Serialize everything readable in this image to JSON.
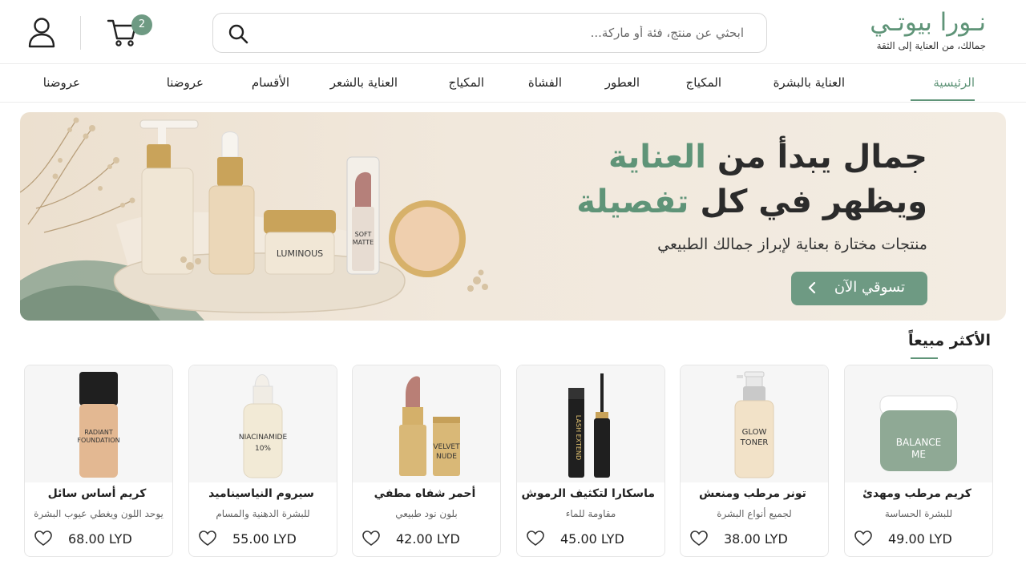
{
  "brand": {
    "name": "نـورا بيوتـي",
    "tagline": "جمالك، من العناية إلى الثقة"
  },
  "search": {
    "placeholder": "ابحثي عن منتج، فئة أو ماركة..."
  },
  "cart": {
    "count": "2"
  },
  "nav": {
    "items": [
      "الرئيسية",
      "العناية بالبشرة",
      "المكياج",
      "العطور",
      "الفشاة",
      "المكياج",
      "العناية بالشعر",
      "الأقسام",
      "عروضنا",
      "عروضنا"
    ]
  },
  "hero": {
    "line1_dark": "جمال يبدأ من",
    "line1_accent": "العناية",
    "line2_dark": "ويظهر في كل",
    "line2_accent": "تفصيلة",
    "subtitle": "منتجات مختارة بعناية لإبراز جمالك الطبيعي",
    "cta": "تسوقي الآن",
    "jar_label": "LUMINOUS",
    "lipstick_label_1": "SOFT",
    "lipstick_label_2": "MATTE"
  },
  "section": {
    "title": "الأكثر مبيعاً"
  },
  "products": [
    {
      "name": "كريم مرطب ومهدئ",
      "desc": "للبشرة الحساسة",
      "price": "49.00 LYD",
      "label1": "BALANCE",
      "label2": "ME"
    },
    {
      "name": "تونر مرطب ومنعش",
      "desc": "لجميع أنواع البشرة",
      "price": "38.00 LYD",
      "label1": "GLOW",
      "label2": "TONER"
    },
    {
      "name": "ماسكارا لتكثيف الرموش",
      "desc": "مقاومة للماء",
      "price": "45.00 LYD",
      "label1": "LASH EXTEND",
      "label2": ""
    },
    {
      "name": "أحمر شفاه مطفي",
      "desc": "بلون نود طبيعي",
      "price": "42.00 LYD",
      "label1": "VELVET",
      "label2": "NUDE"
    },
    {
      "name": "سيروم النياسيناميد",
      "desc": "للبشرة الدهنية والمسام",
      "price": "55.00 LYD",
      "label1": "NIACINAMIDE",
      "label2": "10%"
    },
    {
      "name": "كريم أساس سائل",
      "desc": "يوحد اللون ويغطي عيوب البشرة",
      "price": "68.00 LYD",
      "label1": "RADIANT",
      "label2": "FOUNDATION"
    }
  ],
  "colors": {
    "accent": "#5f9478",
    "button": "#6e9a83",
    "hero_bg": "#efe5d8"
  }
}
